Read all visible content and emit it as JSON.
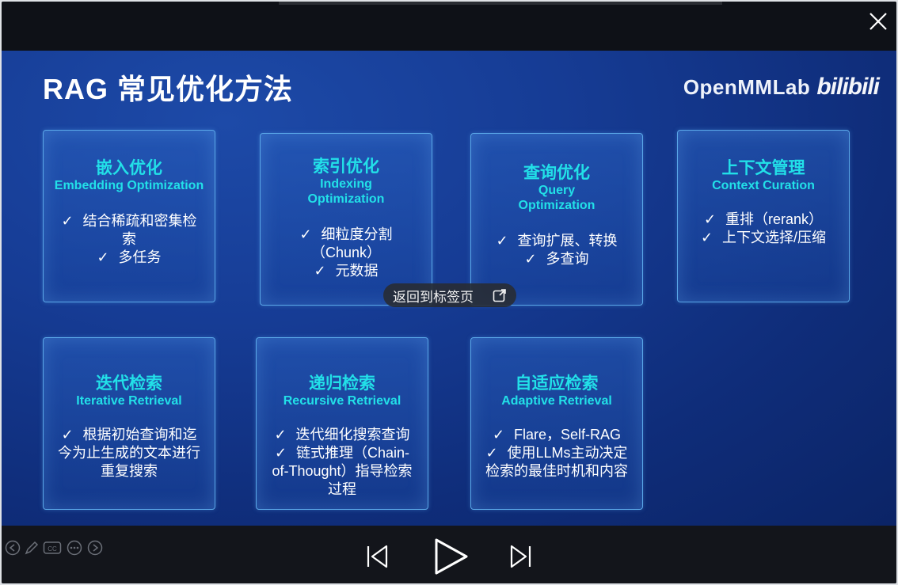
{
  "watermark": {
    "brand": "OpenMMLab",
    "logo": "bilibili"
  },
  "slide": {
    "title": "RAG 常见优化方法",
    "check_mark": "✓",
    "cards": [
      {
        "cn": "嵌入优化",
        "en": "Embedding Optimization",
        "items": [
          "结合稀疏和密集检索",
          "多任务"
        ]
      },
      {
        "cn": "索引优化",
        "en": "Indexing Optimization",
        "items": [
          "细粒度分割（Chunk）",
          "元数据"
        ]
      },
      {
        "cn": "查询优化",
        "en": "Query Optimization",
        "items": [
          "查询扩展、转换",
          "多查询"
        ]
      },
      {
        "cn": "上下文管理",
        "en": "Context Curation",
        "items": [
          "重排（rerank）",
          "上下文选择/压缩"
        ]
      },
      {
        "cn": "迭代检索",
        "en": "Iterative Retrieval",
        "items": [
          "根据初始查询和迄今为止生成的文本进行重复搜索"
        ]
      },
      {
        "cn": "递归检索",
        "en": "Recursive Retrieval",
        "items": [
          "迭代细化搜索查询",
          "链式推理（Chain-of-Thought）指导检索过程"
        ]
      },
      {
        "cn": "自适应检索",
        "en": "Adaptive Retrieval",
        "items": [
          "Flare，Self-RAG",
          "使用LLMs主动决定检索的最佳时机和内容"
        ]
      }
    ]
  },
  "tooltip": {
    "label": "返回到标签页"
  },
  "toolbar": {
    "cc_label": "CC"
  },
  "colors": {
    "accent": "#22e0e8",
    "slide_bg": "#163c95",
    "card_border": "#5aa7e8"
  }
}
